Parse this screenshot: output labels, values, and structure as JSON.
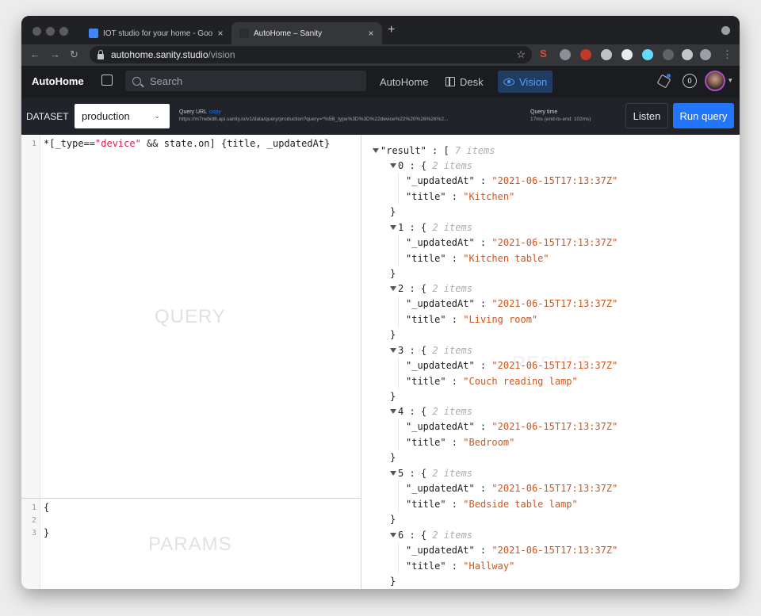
{
  "browser": {
    "tabs": [
      {
        "title": "IOT studio for your home - Goo",
        "active": false,
        "favicon_color": "#4285f4"
      },
      {
        "title": "AutoHome – Sanity",
        "active": true,
        "favicon_color": "#2b2d31"
      }
    ],
    "new_tab": "+",
    "close_glyph": "×",
    "url_host": "autohome.sanity.studio",
    "url_path": "/vision"
  },
  "appbar": {
    "brand": "AutoHome",
    "search_placeholder": "Search",
    "nav": [
      {
        "label": "AutoHome",
        "active": false
      },
      {
        "label": "Desk",
        "active": false
      },
      {
        "label": "Vision",
        "active": true
      }
    ],
    "notification_count": "0"
  },
  "vision": {
    "dataset_label": "DATASET",
    "dataset_value": "production",
    "query_url_label": "Query URL",
    "query_url_copy": "copy",
    "query_url": "https://m7rwbid8.api.sanity.io/v1/data/query/production?query=*%5B_type%3D%3D%22device%22%20%26%26%2...",
    "query_time_label": "Query time",
    "query_time_value": "17ms (end-to-end: 102ms)",
    "listen_label": "Listen",
    "run_label": "Run query"
  },
  "query_editor": {
    "watermark": "QUERY",
    "line_numbers": [
      "1"
    ],
    "code_parts": {
      "prefix": "*[_type==",
      "string": "\"device\"",
      "suffix": " && state.on] {title, _updatedAt}"
    }
  },
  "params_editor": {
    "watermark": "PARAMS",
    "line_numbers": [
      "1",
      "2",
      "3"
    ],
    "lines": [
      "{",
      "",
      "}"
    ]
  },
  "result": {
    "watermark": "RESULT",
    "root_key": "\"result\"",
    "root_meta": "7 items",
    "items": [
      {
        "index": "0",
        "meta": "2 items",
        "updatedAt": "\"2021-06-15T17:13:37Z\"",
        "title": "\"Kitchen\""
      },
      {
        "index": "1",
        "meta": "2 items",
        "updatedAt": "\"2021-06-15T17:13:37Z\"",
        "title": "\"Kitchen table\""
      },
      {
        "index": "2",
        "meta": "2 items",
        "updatedAt": "\"2021-06-15T17:13:37Z\"",
        "title": "\"Living room\""
      },
      {
        "index": "3",
        "meta": "2 items",
        "updatedAt": "\"2021-06-15T17:13:37Z\"",
        "title": "\"Couch reading lamp\""
      },
      {
        "index": "4",
        "meta": "2 items",
        "updatedAt": "\"2021-06-15T17:13:37Z\"",
        "title": "\"Bedroom\""
      },
      {
        "index": "5",
        "meta": "2 items",
        "updatedAt": "\"2021-06-15T17:13:37Z\"",
        "title": "\"Bedside table lamp\""
      },
      {
        "index": "6",
        "meta": "2 items",
        "updatedAt": "\"2021-06-15T17:13:37Z\"",
        "title": "\"Hallway\""
      }
    ],
    "key_updated": "\"_updatedAt\"",
    "key_title": "\"title\""
  },
  "colors": {
    "accent": "#2276fc",
    "string_value": "#d0551c",
    "appbar_bg": "#1a1c1f"
  }
}
